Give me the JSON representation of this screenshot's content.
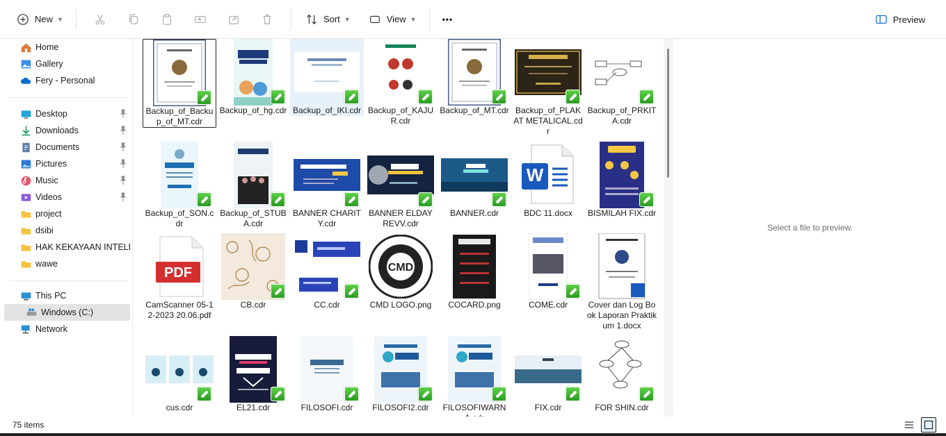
{
  "toolbar": {
    "new_label": "New",
    "sort_label": "Sort",
    "view_label": "View",
    "more_label": "•••",
    "preview_label": "Preview"
  },
  "nav": {
    "quick": [
      "Home",
      "Gallery",
      "Fery - Personal"
    ],
    "pinned": [
      {
        "label": "Desktop",
        "icon": "desktop-icon"
      },
      {
        "label": "Downloads",
        "icon": "download-icon"
      },
      {
        "label": "Documents",
        "icon": "documents-icon"
      },
      {
        "label": "Pictures",
        "icon": "pictures-icon"
      },
      {
        "label": "Music",
        "icon": "music-icon"
      },
      {
        "label": "Videos",
        "icon": "videos-icon"
      }
    ],
    "folders": [
      "project",
      "dsibi",
      "HAK KEKAYAAN INTELEKTUAL",
      "wawe"
    ],
    "this_pc": "This PC",
    "drive": "Windows (C:)",
    "network": "Network"
  },
  "files": [
    {
      "name": "Backup_of_Backup_of_MT.cdr",
      "kind": "cert",
      "state": "focused"
    },
    {
      "name": "Backup_of_hg.cdr",
      "kind": "poster-guru"
    },
    {
      "name": "Backup_of_IKI.cdr",
      "kind": "wide-white",
      "state": "hover"
    },
    {
      "name": "Backup_of_KAJUR.cdr",
      "kind": "poster-faces"
    },
    {
      "name": "Backup_of_MT.cdr",
      "kind": "cert"
    },
    {
      "name": "Backup_of_PLAKAT METALICAL.cdr",
      "kind": "plakat"
    },
    {
      "name": "Backup_of_PRKITA.cdr",
      "kind": "diagram"
    },
    {
      "name": "Backup_of_SON.cdr",
      "kind": "poster-donasi"
    },
    {
      "name": "Backup_of_STUBA.cdr",
      "kind": "poster-korsa"
    },
    {
      "name": "BANNER CHARITY.cdr",
      "kind": "banner-blue"
    },
    {
      "name": "BANNER ELDAY REVV.cdr",
      "kind": "banner-dark"
    },
    {
      "name": "BANNER.cdr",
      "kind": "banner-teal"
    },
    {
      "name": "BDC 11.docx",
      "kind": "word"
    },
    {
      "name": "BISMILAH FIX.cdr",
      "kind": "poster-navy"
    },
    {
      "name": "CamScanner 05-12-2023 20.06.pdf",
      "kind": "pdf"
    },
    {
      "name": "CB.cdr",
      "kind": "batik"
    },
    {
      "name": "CC.cdr",
      "kind": "cards"
    },
    {
      "name": "CMD LOGO.png",
      "kind": "logo"
    },
    {
      "name": "COCARD.png",
      "kind": "cocard"
    },
    {
      "name": "COME.cdr",
      "kind": "poster-come"
    },
    {
      "name": "Cover dan Log Book Laporan Praktikum 1.docx",
      "kind": "doc-cover"
    },
    {
      "name": "cus.cdr",
      "kind": "strip"
    },
    {
      "name": "EL21.cdr",
      "kind": "poster-el21"
    },
    {
      "name": "FILOSOFI.cdr",
      "kind": "filosofi"
    },
    {
      "name": "FILOSOFI2.cdr",
      "kind": "filosofi2"
    },
    {
      "name": "FILOSOFIWARNA.cdr",
      "kind": "filosofi2"
    },
    {
      "name": "FIX.cdr",
      "kind": "fix"
    },
    {
      "name": "FOR SHIN.cdr",
      "kind": "diagram2"
    }
  ],
  "preview": {
    "message": "Select a file to preview."
  },
  "status": {
    "item_count": "75 items"
  },
  "colors": {
    "accent": "#0067c0",
    "badge": "#3cb12f",
    "selection": "#e3e3e3"
  }
}
